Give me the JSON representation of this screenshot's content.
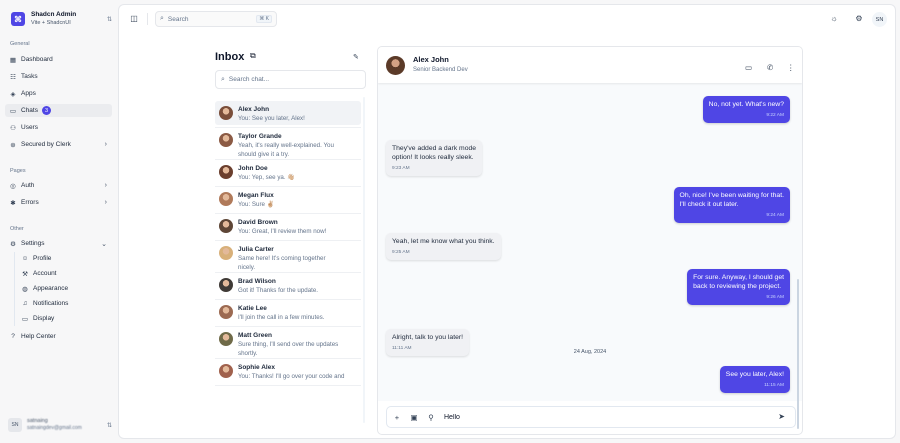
{
  "sidebar": {
    "team": {
      "name": "Shadcn Admin",
      "subtitle": "Vite + ShadcnUI",
      "logo": "⌘"
    },
    "groups": {
      "general": "General",
      "pages": "Pages",
      "other": "Other"
    },
    "nav": {
      "dashboard": "Dashboard",
      "tasks": "Tasks",
      "apps": "Apps",
      "chats": "Chats",
      "chats_badge": "3",
      "users": "Users",
      "secured": "Secured by Clerk",
      "auth": "Auth",
      "errors": "Errors",
      "settings": "Settings",
      "profile": "Profile",
      "account": "Account",
      "appearance": "Appearance",
      "notifications": "Notifications",
      "display": "Display",
      "help": "Help Center"
    },
    "user": {
      "initials": "SN",
      "name": "satnaing",
      "email": "satnaingdev@gmail.com"
    }
  },
  "topbar": {
    "search_placeholder": "Search",
    "search_shortcut": "⌘ K",
    "avatar_initials": "SN"
  },
  "inbox": {
    "title": "Inbox",
    "search_placeholder": "Search chat...",
    "chats": [
      {
        "name": "Alex John",
        "preview": [
          "You: See you later, Alex!"
        ],
        "color": "#7a4e3a"
      },
      {
        "name": "Taylor Grande",
        "preview": [
          "Yeah, it's really well-explained. You",
          "should give it a try."
        ],
        "color": "#8b5a44"
      },
      {
        "name": "John Doe",
        "preview": [
          "You: Yep, see ya. 👋🏼"
        ],
        "color": "#6b3f2e"
      },
      {
        "name": "Megan Flux",
        "preview": [
          "You: Sure ✌🏼"
        ],
        "color": "#b07a5a"
      },
      {
        "name": "David Brown",
        "preview": [
          "You: Great, I'll review them now!"
        ],
        "color": "#5e4636"
      },
      {
        "name": "Julia Carter",
        "preview": [
          "Same here! It's coming together",
          "nicely."
        ],
        "color": "#d8b07a"
      },
      {
        "name": "Brad Wilson",
        "preview": [
          "Got it! Thanks for the update."
        ],
        "color": "#3f3a36"
      },
      {
        "name": "Katie Lee",
        "preview": [
          "I'll join the call in a few minutes."
        ],
        "color": "#9c6a52"
      },
      {
        "name": "Matt Green",
        "preview": [
          "Sure thing, I'll send over the updates",
          "shortly."
        ],
        "color": "#6f6a48"
      },
      {
        "name": "Sophie Alex",
        "preview": [
          "You: Thanks! I'll go over your code and"
        ],
        "color": "#a0614d"
      }
    ]
  },
  "conversation": {
    "name": "Alex John",
    "role": "Senior Backend Dev",
    "date_separator": "24 Aug, 2024",
    "messages": [
      {
        "dir": "out",
        "lines": [
          "No, not yet. What's new?"
        ],
        "time": "9:22 AM"
      },
      {
        "dir": "in",
        "lines": [
          "They've added a dark mode",
          "option! It looks really sleek."
        ],
        "time": "9:23 AM"
      },
      {
        "dir": "out",
        "lines": [
          "Oh, nice! I've been waiting for that.",
          "I'll check it out later."
        ],
        "time": "9:24 AM"
      },
      {
        "dir": "in",
        "lines": [
          "Yeah, let me know what you think."
        ],
        "time": "9:25 AM"
      },
      {
        "dir": "out",
        "lines": [
          "For sure. Anyway, I should get",
          "back to reviewing the project."
        ],
        "time": "9:26 AM"
      },
      {
        "dir": "in",
        "lines": [
          "Alright, talk to you later!"
        ],
        "time": "11:11 AM"
      },
      {
        "dir": "out",
        "lines": [
          "See you later, Alex!"
        ],
        "time": "11:15 AM"
      }
    ],
    "composer_value": "Hello"
  }
}
